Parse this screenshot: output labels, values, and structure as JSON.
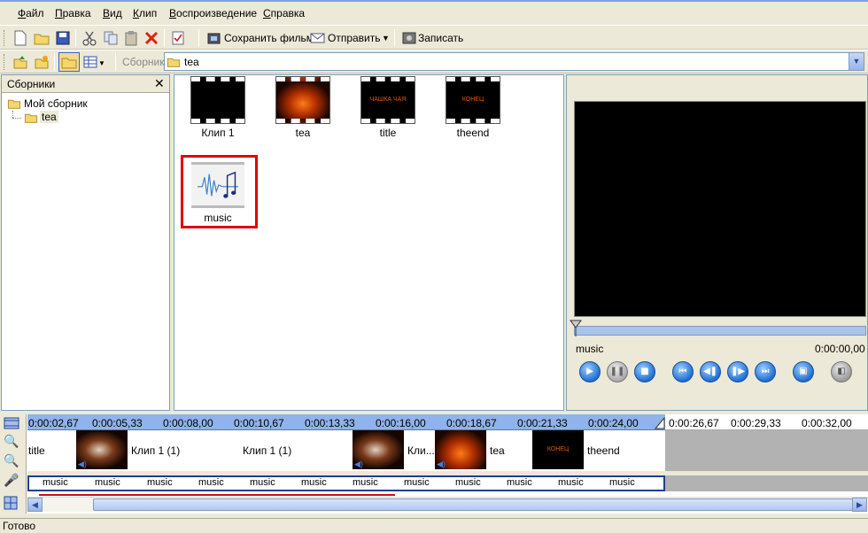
{
  "menu": [
    "Файл",
    "Правка",
    "Вид",
    "Клип",
    "Воспроизведение",
    "Справка"
  ],
  "toolbar": {
    "save_movie": "Сохранить фильм",
    "send": "Отправить",
    "record": "Записать",
    "collection_label": "Сборник",
    "collection_value": "tea"
  },
  "collections": {
    "header": "Сборники",
    "root": "Мой сборник",
    "child": "tea"
  },
  "clips": [
    {
      "label": "Клип 1"
    },
    {
      "label": "tea"
    },
    {
      "label": "title",
      "thumb_text": "ЧАШКА ЧАЯ"
    },
    {
      "label": "theend",
      "thumb_text": "КОНЕЦ"
    },
    {
      "label": "music"
    }
  ],
  "preview": {
    "title": "music",
    "time": "0:00:00,00"
  },
  "timeline": {
    "ruler": [
      "0:00:02,67",
      "0:00:05,33",
      "0:00:08,00",
      "0:00:10,67",
      "0:00:13,33",
      "0:00:16,00",
      "0:00:18,67",
      "0:00:21,33",
      "0:00:24,00",
      "0:00:26,67",
      "0:00:29,33",
      "0:00:32,00"
    ],
    "video_labels": [
      "title",
      "Клип 1 (1)",
      "Клип 1 (1)",
      "Кли...",
      "tea",
      "theend"
    ],
    "audio_label": "music",
    "end_thumb_text": "КОНЕЦ"
  },
  "status": "Готово",
  "colors": {
    "selection_border": "#e00000",
    "ruler_blue": "#8fb3ea",
    "timeline_gray": "#b2b2b2",
    "audio_border": "#1f3f8f"
  }
}
